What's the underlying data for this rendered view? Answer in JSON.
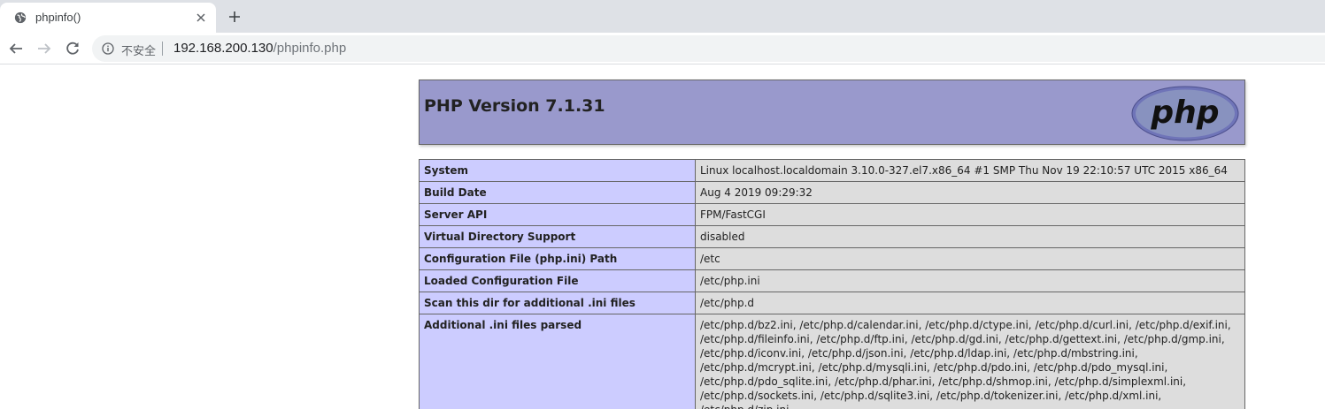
{
  "browser": {
    "tab": {
      "title": "phpinfo()"
    },
    "toolbar": {
      "security_label": "不安全",
      "url_host": "192.168.200.130",
      "url_path": "/phpinfo.php"
    }
  },
  "phpinfo": {
    "version_title": "PHP Version 7.1.31",
    "logo_text": "php",
    "rows": [
      {
        "key": "System",
        "value": "Linux localhost.localdomain 3.10.0-327.el7.x86_64 #1 SMP Thu Nov 19 22:10:57 UTC 2015 x86_64"
      },
      {
        "key": "Build Date",
        "value": "Aug 4 2019 09:29:32"
      },
      {
        "key": "Server API",
        "value": "FPM/FastCGI"
      },
      {
        "key": "Virtual Directory Support",
        "value": "disabled"
      },
      {
        "key": "Configuration File (php.ini) Path",
        "value": "/etc"
      },
      {
        "key": "Loaded Configuration File",
        "value": "/etc/php.ini"
      },
      {
        "key": "Scan this dir for additional .ini files",
        "value": "/etc/php.d"
      },
      {
        "key": "Additional .ini files parsed",
        "value": "/etc/php.d/bz2.ini, /etc/php.d/calendar.ini, /etc/php.d/ctype.ini, /etc/php.d/curl.ini, /etc/php.d/exif.ini,\n/etc/php.d/fileinfo.ini, /etc/php.d/ftp.ini, /etc/php.d/gd.ini, /etc/php.d/gettext.ini, /etc/php.d/gmp.ini,\n/etc/php.d/iconv.ini, /etc/php.d/json.ini, /etc/php.d/ldap.ini, /etc/php.d/mbstring.ini,\n/etc/php.d/mcrypt.ini, /etc/php.d/mysqli.ini, /etc/php.d/pdo.ini, /etc/php.d/pdo_mysql.ini,\n/etc/php.d/pdo_sqlite.ini, /etc/php.d/phar.ini, /etc/php.d/shmop.ini, /etc/php.d/simplexml.ini,\n/etc/php.d/sockets.ini, /etc/php.d/sqlite3.ini, /etc/php.d/tokenizer.ini, /etc/php.d/xml.ini, /etc/php.d/zip.ini"
      }
    ]
  },
  "icons": {
    "favicon": "globe-icon",
    "close": "close-icon",
    "new_tab": "plus-icon",
    "back": "back-arrow-icon",
    "forward": "forward-arrow-icon",
    "reload": "reload-icon",
    "info": "info-icon"
  },
  "colors": {
    "header_bg": "#9999cc",
    "key_cell_bg": "#ccccff",
    "value_cell_bg": "#dddddd",
    "tabstrip_bg": "#dee1e6"
  }
}
